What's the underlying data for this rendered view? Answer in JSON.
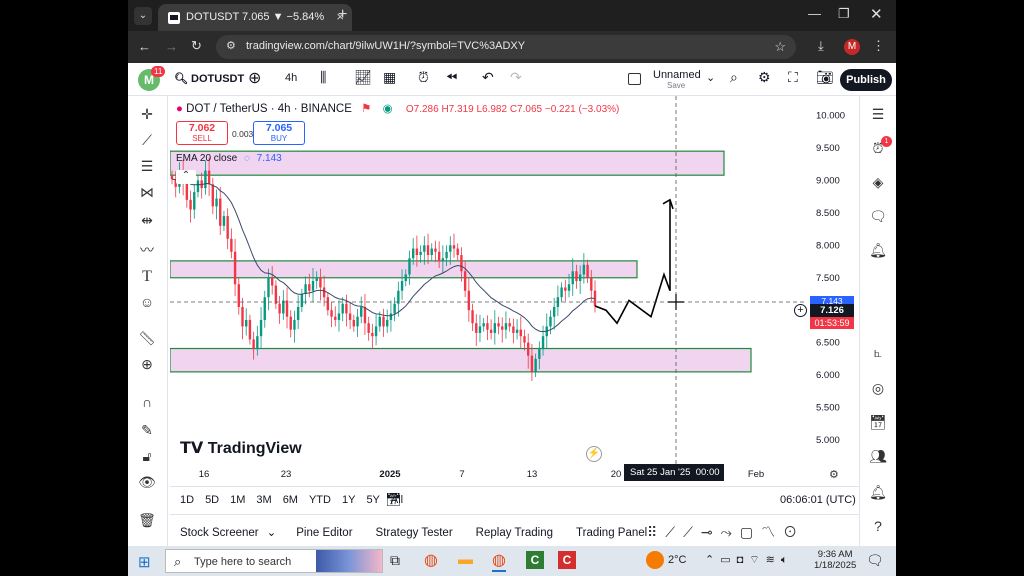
{
  "browser": {
    "tab_title": "DOTUSDT 7.065 ▼ −5.84% Unn",
    "url": "tradingview.com/chart/9ilwUW1H/?symbol=TVC%3ADXY",
    "profile_letter": "M"
  },
  "toolbar": {
    "avatar_letter": "M",
    "notif_count": "11",
    "symbol": "DOTUSDT",
    "interval": "4h",
    "layout_name": "Unnamed",
    "save_label": "Save",
    "publish_label": "Publish"
  },
  "legend": {
    "symbol_line": "DOT / TetherUS · 4h · BINANCE",
    "ohlc": "O7.286 H7.319 L6.982 C7.065 −0.221 (−3.03%)",
    "sell_price": "7.062",
    "sell_label": "SELL",
    "spread": "0.003",
    "buy_price": "7.065",
    "buy_label": "BUY",
    "indicator": "EMA 20 close",
    "indicator_value": "7.143"
  },
  "price_axis": {
    "ticks": [
      "10.000",
      "9.500",
      "9.000",
      "8.500",
      "8.000",
      "7.500",
      "7.000",
      "6.500",
      "6.000",
      "5.500",
      "5.000"
    ],
    "ema_label": "7.143",
    "crosshair_price": "7.126",
    "countdown": "01:53:59"
  },
  "time_axis": {
    "ticks": [
      "16",
      "23",
      "2025",
      "7",
      "13",
      "20",
      "Feb"
    ],
    "crosshair_time": "Sat 25 Jan '25",
    "crosshair_clock": "00:00"
  },
  "watermark": "TradingView",
  "bottombar": {
    "ranges": [
      "1D",
      "5D",
      "1M",
      "3M",
      "6M",
      "YTD",
      "1Y",
      "5Y",
      "All"
    ],
    "clock": "06:06:01 (UTC)"
  },
  "panels": [
    "Stock Screener",
    "Pine Editor",
    "Strategy Tester",
    "Replay Trading",
    "Trading Panel"
  ],
  "taskbar": {
    "search_placeholder": "Type here to search",
    "temperature": "2°C",
    "time": "9:36 AM",
    "date": "1/18/2025"
  },
  "right_toolbar": {
    "alert_badge": "1"
  },
  "colors": {
    "zone_fill": "#f0d4f0",
    "zone_border": "#1e8a3c",
    "crosshair_price_bg": "#131722",
    "countdown_bg": "#f23645",
    "ema_bg": "#2962ff",
    "up": "#089981",
    "down": "#f23645"
  },
  "chart_data": {
    "type": "candlestick",
    "ylim": [
      4.6,
      10.3
    ],
    "candle_closes": [
      9.02,
      8.9,
      9.12,
      8.95,
      8.7,
      8.55,
      8.82,
      9.0,
      8.88,
      9.15,
      8.94,
      8.6,
      8.72,
      8.3,
      8.45,
      8.1,
      7.9,
      7.4,
      7.05,
      6.75,
      6.85,
      6.55,
      6.4,
      6.6,
      6.85,
      7.2,
      7.5,
      7.38,
      7.1,
      6.95,
      7.15,
      6.9,
      6.7,
      6.85,
      7.05,
      7.25,
      7.4,
      7.3,
      7.45,
      7.5,
      7.35,
      7.2,
      7.0,
      6.9,
      6.85,
      6.95,
      7.1,
      6.95,
      6.85,
      6.75,
      6.9,
      7.05,
      6.8,
      6.65,
      6.6,
      6.75,
      6.9,
      6.75,
      6.85,
      6.95,
      7.1,
      7.3,
      7.45,
      7.55,
      7.8,
      7.95,
      7.85,
      7.9,
      8.0,
      7.85,
      7.95,
      7.9,
      7.75,
      7.8,
      7.9,
      8.0,
      7.95,
      7.85,
      7.6,
      7.3,
      7.0,
      6.8,
      6.65,
      6.75,
      6.8,
      6.7,
      6.65,
      6.8,
      6.75,
      6.7,
      6.8,
      6.75,
      6.65,
      6.7,
      6.6,
      6.5,
      6.3,
      6.05,
      6.25,
      6.4,
      6.6,
      6.75,
      6.9,
      7.05,
      7.2,
      7.35,
      7.3,
      7.4,
      7.6,
      7.45,
      7.55,
      7.7,
      7.5,
      7.3,
      7.065
    ],
    "ema_last": 7.143,
    "zones": [
      {
        "name": "upper-resistance",
        "low": 9.08,
        "high": 9.45
      },
      {
        "name": "middle-resistance",
        "low": 7.5,
        "high": 7.76
      },
      {
        "name": "lower-support",
        "low": 6.05,
        "high": 6.41
      }
    ],
    "projection": [
      [
        7.065,
        7.0
      ],
      [
        7.0,
        6.8
      ],
      [
        6.8,
        7.15
      ],
      [
        7.15,
        6.9
      ],
      [
        6.9,
        7.55
      ],
      [
        7.55,
        7.3
      ],
      [
        7.3,
        8.7
      ]
    ]
  }
}
